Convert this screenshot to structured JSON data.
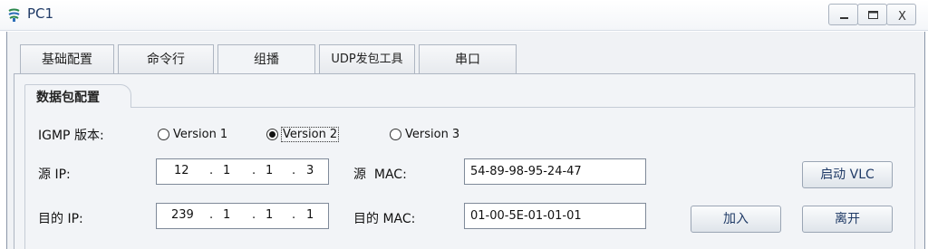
{
  "window": {
    "title": "PC1",
    "minimize": "_",
    "maximize": "□",
    "close": "X",
    "app_icon": "network-pc-icon"
  },
  "tabs": [
    {
      "label": "基础配置",
      "active": false
    },
    {
      "label": "命令行",
      "active": false
    },
    {
      "label": "组播",
      "active": true
    },
    {
      "label": "UDP发包工具",
      "active": false
    },
    {
      "label": "串口",
      "active": false
    }
  ],
  "section": {
    "title": "数据包配置"
  },
  "igmp": {
    "label": "IGMP 版本:",
    "options": [
      {
        "label": "Version 1",
        "selected": false
      },
      {
        "label": "Version 2",
        "selected": true
      },
      {
        "label": "Version 3",
        "selected": false
      }
    ]
  },
  "source": {
    "ip_label": "源 IP:",
    "ip": [
      "12",
      "1",
      "1",
      "3"
    ],
    "mac_label": "源  MAC:",
    "mac": "54-89-98-95-24-47"
  },
  "dest": {
    "ip_label": "目的 IP:",
    "ip": [
      "239",
      "1",
      "1",
      "1"
    ],
    "mac_label": "目的 MAC:",
    "mac": "01-00-5E-01-01-01"
  },
  "buttons": {
    "vlc": "启动 VLC",
    "join": "加入",
    "leave": "离开"
  },
  "ip_separator": "."
}
